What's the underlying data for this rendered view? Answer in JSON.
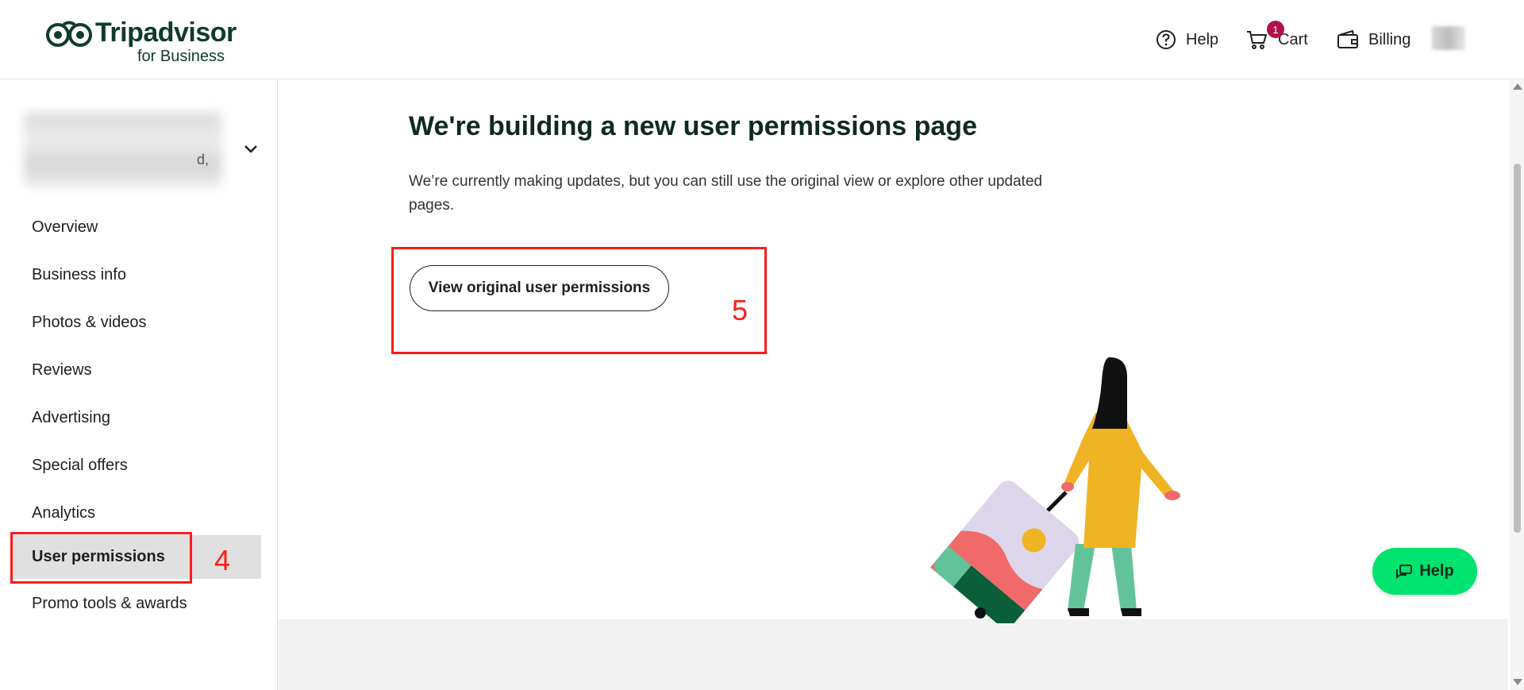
{
  "header": {
    "logo_text": "Tripadvisor",
    "logo_sub": "for Business",
    "nav": {
      "help_label": "Help",
      "cart_label": "Cart",
      "cart_count": "1",
      "billing_label": "Billing"
    },
    "icons": [
      "help-circle-icon",
      "cart-icon",
      "wallet-icon"
    ]
  },
  "sidebar": {
    "account_suffix": "d,",
    "items": [
      {
        "label": "Overview"
      },
      {
        "label": "Business info"
      },
      {
        "label": "Photos & videos"
      },
      {
        "label": "Reviews"
      },
      {
        "label": "Advertising"
      },
      {
        "label": "Special offers"
      },
      {
        "label": "Analytics"
      },
      {
        "label": "User permissions",
        "active": true
      },
      {
        "label": "Promo tools & awards"
      }
    ]
  },
  "annotations": {
    "sidebar_marker": "4",
    "button_marker": "5",
    "color": "#ff1a1a"
  },
  "main": {
    "title": "We're building a new user permissions page",
    "description": "We’re currently making updates, but you can still use the original view or explore other updated pages.",
    "button_label": "View original user permissions"
  },
  "help_fab": {
    "label": "Help"
  },
  "colors": {
    "brand_green": "#00e36e",
    "dark_green": "#0f3b2e",
    "badge": "#b0124c",
    "active_bg": "#e0e0e0"
  }
}
